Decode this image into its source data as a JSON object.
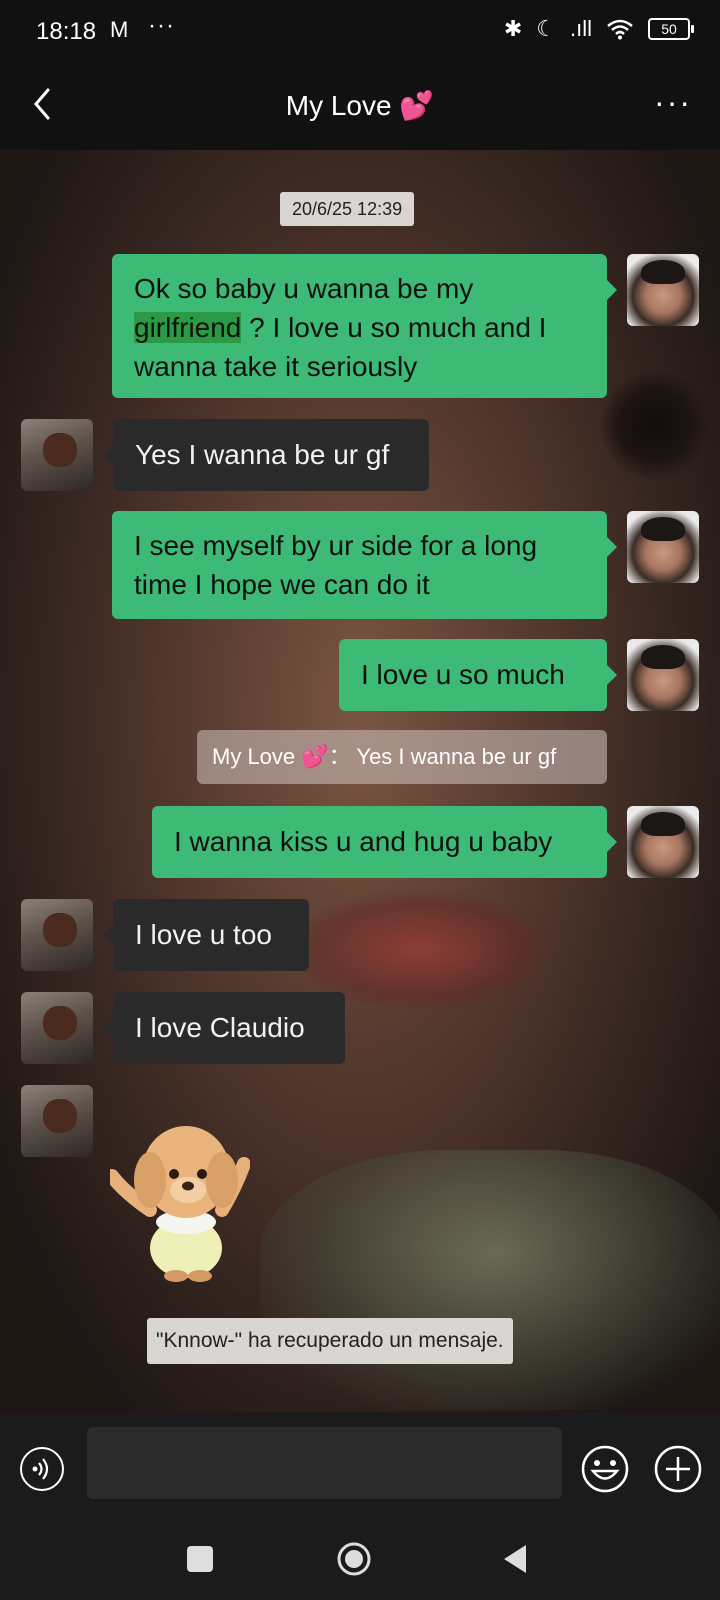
{
  "status": {
    "time": "18:18",
    "mail_icon": "M",
    "more_dots": "···",
    "bluetooth_icon": "✱",
    "moon_icon": "☾",
    "signal_icon": ".ıll",
    "wifi_icon": "wifi",
    "battery": "50"
  },
  "header": {
    "title": "My Love",
    "title_emoji": "💕",
    "menu": "···"
  },
  "chat": {
    "timestamp": "20/6/25 12:39",
    "messages": [
      {
        "from": "me",
        "text_pre": "Ok so baby u wanna be my",
        "highlight": "girlfriend",
        "text_post": "? I love u so much and I wanna take it seriously"
      },
      {
        "from": "her",
        "text": "Yes I wanna be ur gf"
      },
      {
        "from": "me",
        "text": "I see myself by ur side for a long time I hope we can do it"
      },
      {
        "from": "me",
        "text": "I love u so much"
      },
      {
        "from": "me",
        "text": "I wanna kiss u and hug u baby"
      },
      {
        "from": "her",
        "text": "I love u too"
      },
      {
        "from": "her",
        "text": "I love Claudio"
      }
    ],
    "quote": {
      "name": "My Love",
      "emoji": "💕",
      "separator": "：",
      "text": "Yes I wanna be ur gf"
    },
    "system_note": "\"Knnow-\" ha recuperado un mensaje."
  },
  "input": {
    "placeholder": ""
  },
  "colors": {
    "outgoing_bubble": "#3dba75",
    "incoming_bubble": "#2a2a2b",
    "bar_background": "#1b1b1b"
  },
  "icons": [
    "back-arrow-icon",
    "more-icon",
    "voice-icon",
    "emoji-icon",
    "plus-icon",
    "square-icon",
    "home-icon",
    "triangle-back-icon"
  ]
}
